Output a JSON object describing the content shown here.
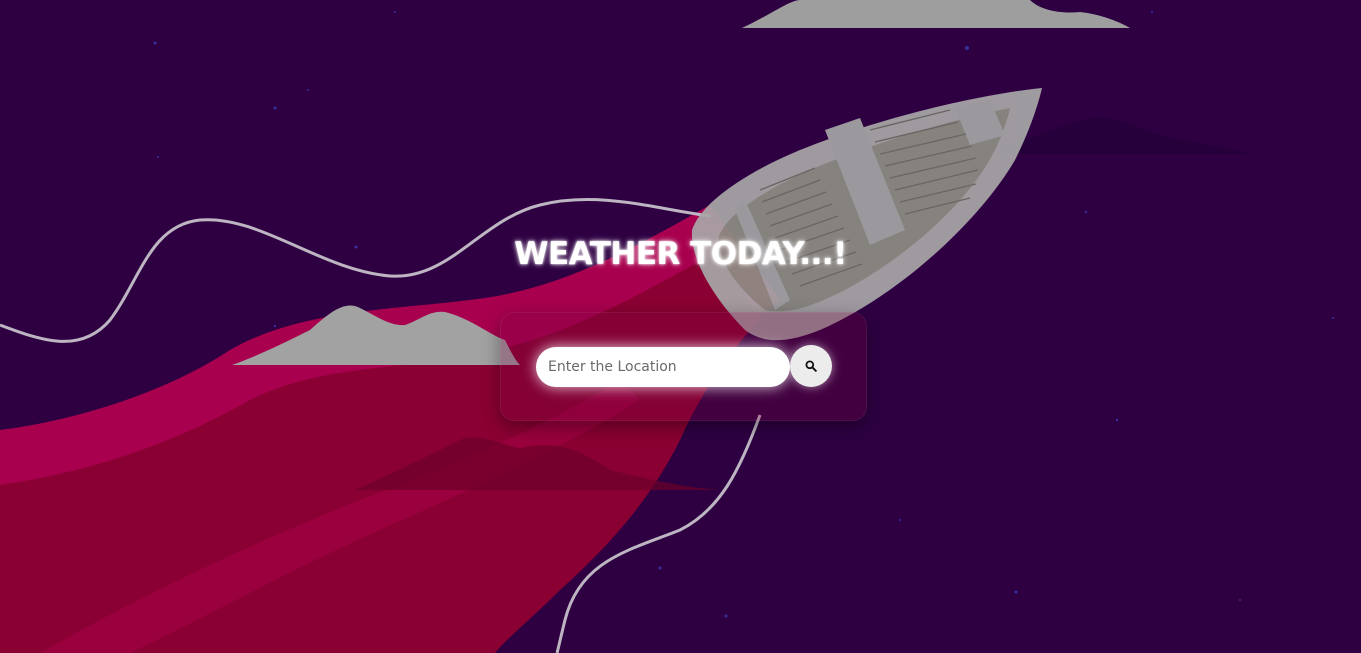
{
  "page": {
    "title": "WEATHER TODAY...!"
  },
  "search": {
    "placeholder": "Enter the Location",
    "value": "",
    "button_icon": "search-icon"
  },
  "colors": {
    "background": "#2e0042",
    "river": "#8a0032",
    "river_light": "#b0004f",
    "clouds": "#a6a6a6",
    "boat": "#9b9b9b"
  }
}
